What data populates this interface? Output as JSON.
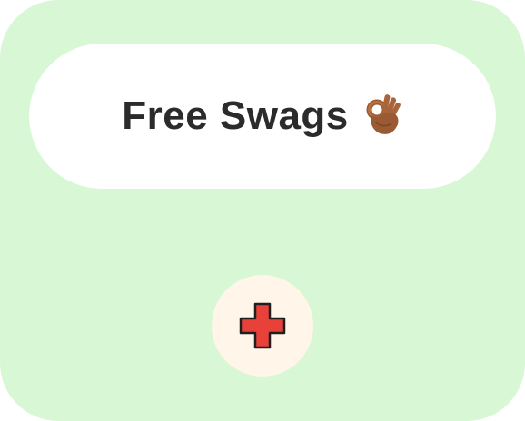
{
  "card": {
    "background_color": "#d8f7d4"
  },
  "title": {
    "text": "Free Swags",
    "emoji_icon": "ok-hand-icon"
  },
  "add_button": {
    "icon": "plus-icon",
    "icon_color": "#e8413a",
    "background_color": "#fff5e8"
  }
}
